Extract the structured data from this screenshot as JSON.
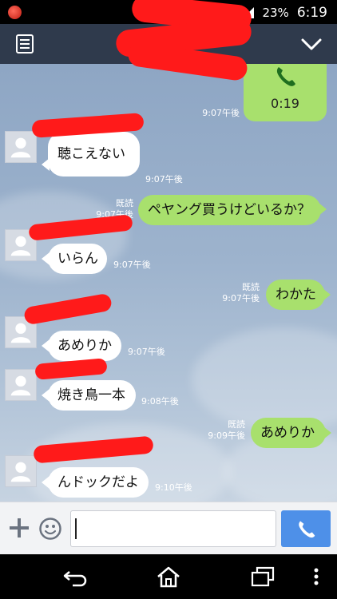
{
  "status_bar": {
    "battery": "23%",
    "time": "6:19"
  },
  "call": {
    "duration": "0:19",
    "time": "9:07午後"
  },
  "messages": [
    {
      "side": "in",
      "text": "聴こえない",
      "time": "9:07午後"
    },
    {
      "side": "out",
      "text": "ペヤング買うけどいるか？",
      "read": "既読",
      "time": "9:07午後"
    },
    {
      "side": "in",
      "text": "いらん",
      "time": "9:07午後"
    },
    {
      "side": "out",
      "text": "わかた",
      "read": "既読",
      "time": "9:07午後"
    },
    {
      "side": "in",
      "text": "あめりか",
      "time": "9:07午後"
    },
    {
      "side": "in",
      "text": "焼き鳥一本",
      "time": "9:08午後"
    },
    {
      "side": "out",
      "text": "あめりか",
      "read": "既読",
      "time": "9:09午後"
    },
    {
      "side": "in",
      "text": "んドックだよ",
      "time": "9:10午後"
    }
  ],
  "input": {
    "value": ""
  },
  "colors": {
    "header": "#2f3a4c",
    "bubble_out": "#a8e06d",
    "bubble_in": "#ffffff",
    "call_button": "#4e90e8",
    "redaction": "#ff1a1a"
  },
  "icons": {
    "header_left": "menu-icon",
    "header_right": "chevron-down-icon",
    "call": "phone-icon",
    "input_left": [
      "plus-icon",
      "emoji-icon"
    ],
    "nav": [
      "back-icon",
      "home-icon",
      "recent-apps-icon",
      "more-icon"
    ]
  }
}
